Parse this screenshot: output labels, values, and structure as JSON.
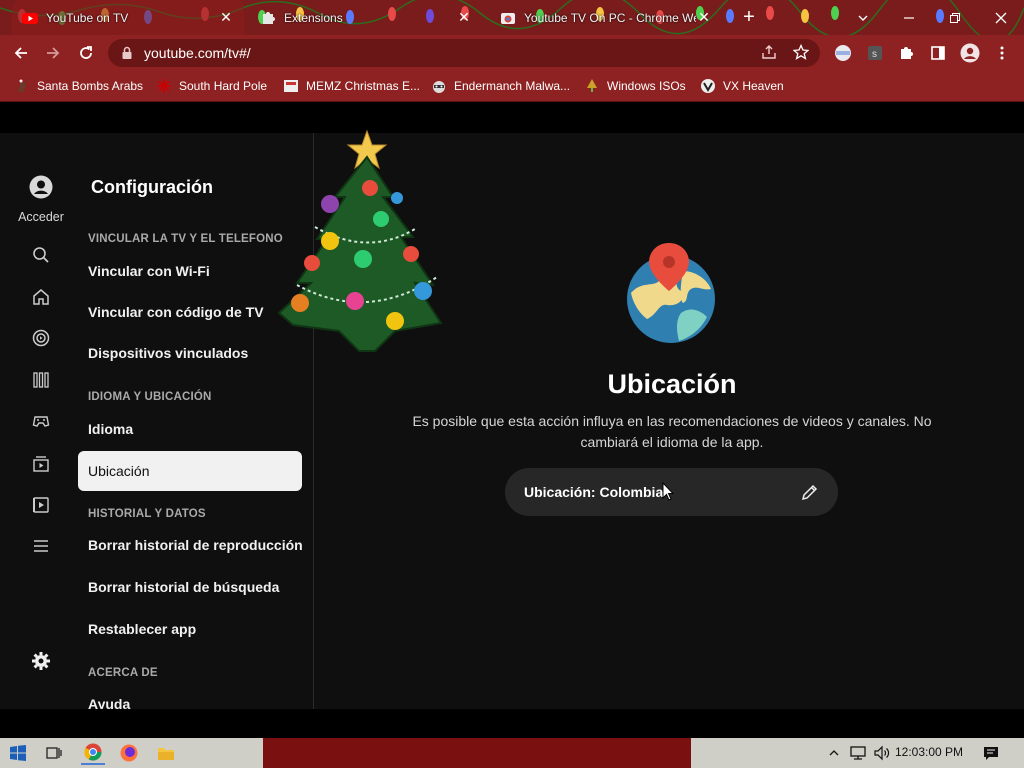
{
  "browser": {
    "tabs": [
      {
        "title": "YouTube on TV",
        "icon": "youtube-icon",
        "active": true
      },
      {
        "title": "Extensions",
        "icon": "puzzle-icon",
        "active": false
      },
      {
        "title": "Youtube TV On PC - Chrome We",
        "icon": "chrome-webstore-icon",
        "active": false
      }
    ],
    "url": "youtube.com/tv#/",
    "bookmarks": [
      {
        "label": "Santa Bombs Arabs",
        "icon": "santa-icon"
      },
      {
        "label": "South Hard Pole",
        "icon": "snowflake-icon"
      },
      {
        "label": "MEMZ Christmas E...",
        "icon": "memz-icon"
      },
      {
        "label": "Endermanch Malwa...",
        "icon": "raccoon-icon"
      },
      {
        "label": "Windows ISOs",
        "icon": "tree-icon"
      },
      {
        "label": "VX Heaven",
        "icon": "vx-icon"
      }
    ],
    "theme_color": "#8e2222"
  },
  "rail": {
    "acceder_label": "Acceder",
    "items": [
      "search-icon",
      "home-icon",
      "shorts-icon",
      "subscriptions-icon",
      "gaming-icon",
      "library-icon",
      "queue-icon",
      "menu-icon",
      "gear-icon"
    ]
  },
  "settings": {
    "title": "Configuración",
    "sections": [
      {
        "header": "VINCULAR LA TV Y EL TELEFONO",
        "items": [
          "Vincular con Wi-Fi",
          "Vincular con código de TV",
          "Dispositivos vinculados"
        ]
      },
      {
        "header": "IDIOMA Y UBICACIÓN",
        "items": [
          "Idioma",
          "Ubicación"
        ]
      },
      {
        "header": "HISTORIAL Y DATOS",
        "items": [
          "Borrar historial de reproducción",
          "Borrar historial de búsqueda",
          "Restablecer app"
        ]
      },
      {
        "header": "ACERCA DE",
        "items": [
          "Ayuda"
        ]
      }
    ],
    "selected_item": "Ubicación"
  },
  "content": {
    "title": "Ubicación",
    "description": "Es posible que esta acción influya en las recomendaciones de videos y canales. No cambiará el idioma de la app.",
    "location_button_label": "Ubicación: Colombia"
  },
  "taskbar": {
    "clock": "12:03:00 PM",
    "apps": [
      "windows-start-icon",
      "task-view-icon",
      "chrome-icon",
      "firefox-icon",
      "file-explorer-icon"
    ]
  }
}
